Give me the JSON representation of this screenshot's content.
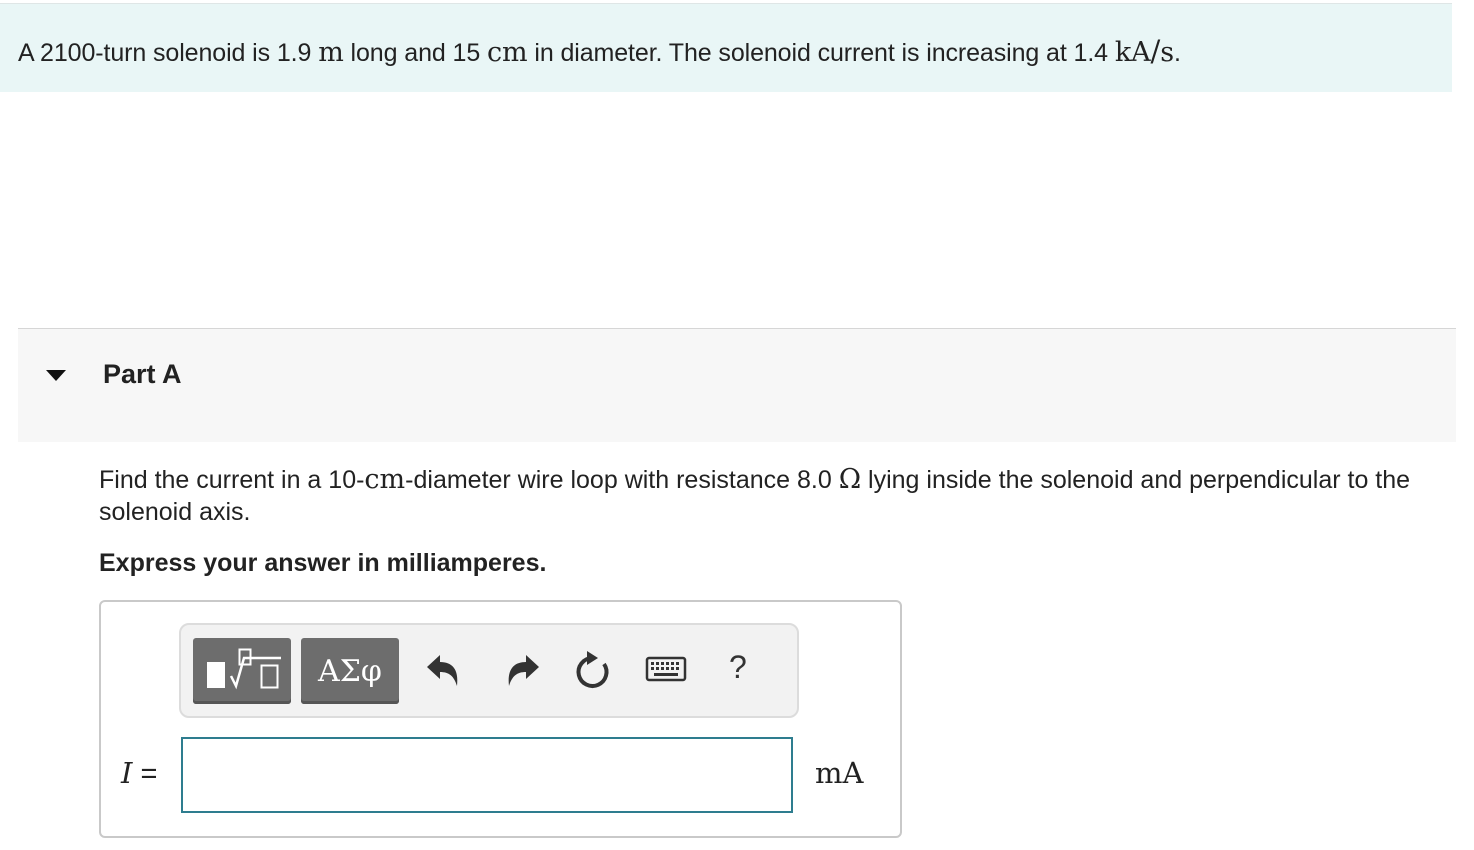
{
  "problem": {
    "p1": "A 2100-turn solenoid is 1.9 ",
    "u1": "m",
    "p2": " long and 15 ",
    "u2": "cm",
    "p3": " in diameter. The solenoid current is increasing at 1.4 ",
    "u3a": "kA",
    "u3slash": "/",
    "u3b": "s",
    "p4": "."
  },
  "part": {
    "title": "Part A"
  },
  "question": {
    "q1": "Find the current in a 10-",
    "qu1": "cm",
    "q2": "-diameter wire loop with resistance 8.0 ",
    "qu2": "Ω",
    "q3": " lying inside the solenoid and perpendicular to the solenoid axis."
  },
  "instruction": "Express your answer in milliamperes.",
  "toolbar": {
    "symbols_label": "ΑΣφ",
    "help_label": "?"
  },
  "answer": {
    "variable": "I",
    "equals": "=",
    "value": "",
    "unit": "mA"
  },
  "colors": {
    "banner_bg": "#e9f6f6",
    "part_bg": "#f7f7f7",
    "button_bg": "#6d6d6d",
    "input_border": "#2e7d8f"
  }
}
